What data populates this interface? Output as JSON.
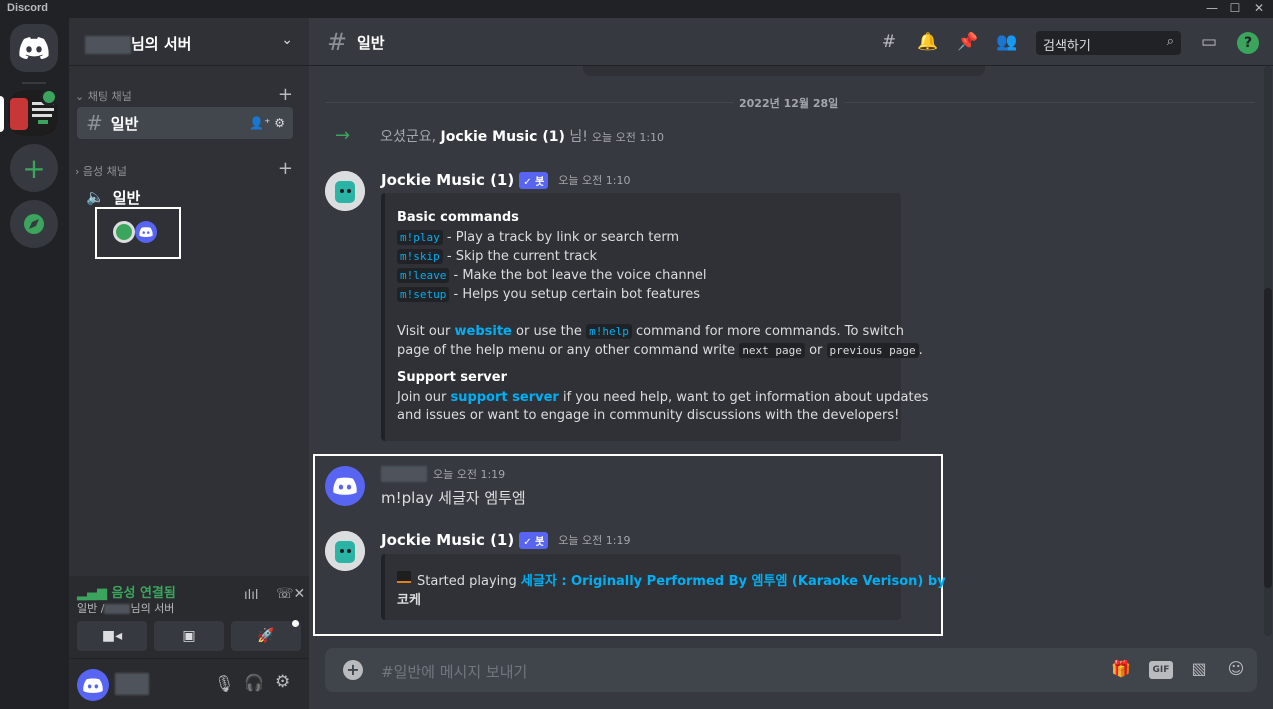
{
  "window": {
    "title": "Discord",
    "minimize": "—",
    "maximize": "☐",
    "close": "✕"
  },
  "server": {
    "name_suffix": "님의 서버"
  },
  "sidebar": {
    "text_category": "채팅 채널",
    "voice_category": "음성 채널",
    "text_channel": "일반",
    "voice_channel": "일반"
  },
  "voice_panel": {
    "status": "음성 연결됨",
    "sub_prefix": "일반 /",
    "sub_suffix": "님의 서버"
  },
  "channel_header": {
    "name": "일반",
    "search_placeholder": "검색하기",
    "help": "?"
  },
  "messages": {
    "date_divider": "2022년 12월 28일",
    "join": {
      "prefix": "오셨군요,",
      "user": "Jockie Music (1)",
      "suffix": "님!",
      "time": "오늘 오전 1:10"
    },
    "bot1": {
      "author": "Jockie Music (1)",
      "tag": "✓ 봇",
      "time": "오늘 오전 1:10",
      "embed": {
        "title1": "Basic commands",
        "cmds": [
          {
            "code": "m!play",
            "desc": "- Play a track by link or search term"
          },
          {
            "code": "m!skip",
            "desc": "- Skip the current track"
          },
          {
            "code": "m!leave",
            "desc": "- Make the bot leave the voice channel"
          },
          {
            "code": "m!setup",
            "desc": "- Helps you setup certain bot features"
          }
        ],
        "p1_a": "Visit our",
        "p1_link": "website",
        "p1_b": "or use the",
        "p1_code": "m!help",
        "p1_c": "command for more commands. To switch",
        "p2_a": "page of the help menu or any other command write",
        "p2_code1": "next page",
        "p2_b": "or",
        "p2_code2": "previous page",
        "p2_c": ".",
        "title2": "Support server",
        "p3_a": "Join our",
        "p3_link": "support server",
        "p3_b": "if you need help, want to get information about updates",
        "p4": "and issues or want to engage in community discussions with the developers!"
      }
    },
    "user": {
      "time": "오늘 오전 1:19",
      "text": "m!play 세글자 엠투엠"
    },
    "bot2": {
      "author": "Jockie Music (1)",
      "tag": "✓ 봇",
      "time": "오늘 오전 1:19",
      "started": "Started playing",
      "track_line1": "세글자 : Originally Performed By 엠투엠 (Karaoke Verison) by",
      "track_line2": "코케"
    }
  },
  "composer": {
    "placeholder": "#일반에 메시지 보내기",
    "gif": "GIF"
  },
  "colors": {
    "accent": "#5865f2",
    "green": "#3ba55d",
    "link": "#00aff4"
  }
}
